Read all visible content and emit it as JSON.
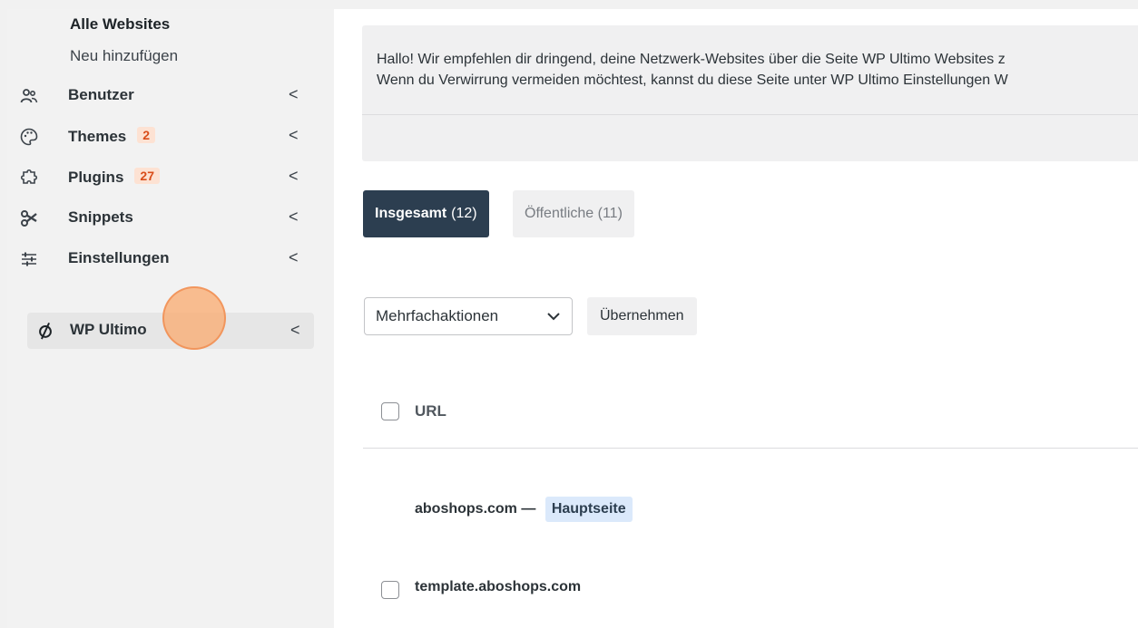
{
  "sidebar": {
    "submenu": {
      "current": "Alle Websites",
      "second": "Neu hinzufügen"
    },
    "items": [
      {
        "label": "Benutzer",
        "icon": "users-icon"
      },
      {
        "label": "Themes",
        "icon": "palette-icon",
        "badge": "2"
      },
      {
        "label": "Plugins",
        "icon": "plugin-icon",
        "badge": "27"
      },
      {
        "label": "Snippets",
        "icon": "scissors-icon"
      },
      {
        "label": "Einstellungen",
        "icon": "sliders-icon"
      },
      {
        "label": "WP Ultimo",
        "icon": "wp-ultimo-icon"
      }
    ],
    "chevron": "<"
  },
  "notice": {
    "line1": "Hallo! Wir empfehlen dir dringend, deine Netzwerk-Websites über die Seite WP Ultimo Websites z",
    "line2": "Wenn du Verwirrung vermeiden möchtest, kannst du diese Seite unter WP Ultimo Einstellungen W"
  },
  "tabs": {
    "all_label": "Insgesamt",
    "all_count": "(12)",
    "public_label": "Öffentliche (11)"
  },
  "bulk": {
    "selected": "Mehrfachaktionen",
    "apply_label": "Übernehmen"
  },
  "table": {
    "column_url": "URL",
    "rows": [
      {
        "title": "aboshops.com —",
        "badge": "Hauptseite"
      },
      {
        "title": "template.aboshops.com"
      }
    ]
  },
  "colors": {
    "accent_dark": "#2c3e50",
    "badge_orange_bg": "#fde2d3",
    "badge_orange_text": "#d94d1a",
    "site_badge_bg": "#dbe9fb"
  }
}
